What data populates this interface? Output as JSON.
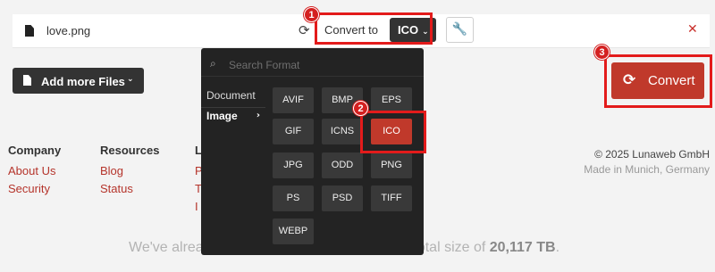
{
  "file_row": {
    "file_name": "love.png",
    "refresh_glyph": "⟳",
    "convert_to_label": "Convert to",
    "selected_format": "ICO",
    "chevron_glyph": "⌄",
    "wrench_glyph": "🔧",
    "remove_glyph": "✕"
  },
  "toolbar": {
    "add_more_label": "Add more Files",
    "add_more_chevron": "⌄",
    "convert_label": "Convert",
    "convert_icon_glyph": "⟳"
  },
  "annotations": {
    "step1": "1",
    "step2": "2",
    "step3": "3",
    "highlight_color": "#e31b1b"
  },
  "dropdown": {
    "search_icon_glyph": "⌕",
    "search_placeholder": "Search Format",
    "categories": [
      {
        "label": "Document",
        "active": false
      },
      {
        "label": "Image",
        "active": true,
        "chevron": "›"
      }
    ],
    "formats": [
      "AVIF",
      "BMP",
      "EPS",
      "GIF",
      "ICNS",
      "ICO",
      "JPG",
      "ODD",
      "PNG",
      "PS",
      "PSD",
      "TIFF",
      "WEBP"
    ],
    "selected_format": "ICO"
  },
  "footer": {
    "company_heading": "Company",
    "company_links": [
      "About Us",
      "Security"
    ],
    "resources_heading": "Resources",
    "resources_links": [
      "Blog",
      "Status"
    ],
    "legal_heading": "L",
    "legal_links": [
      "P",
      "T",
      "I"
    ],
    "copyright": "© 2025 Lunaweb GmbH",
    "made_in": "Made in Munich, Germany",
    "stats_prefix": "We've alrea",
    "stats_middle": "h a total size of ",
    "stats_total": "20,117 TB",
    "stats_suffix": "."
  },
  "colors": {
    "accent": "#c0392b",
    "dark_button": "#333333",
    "dropdown_bg": "#232323",
    "link": "#b5342b"
  }
}
